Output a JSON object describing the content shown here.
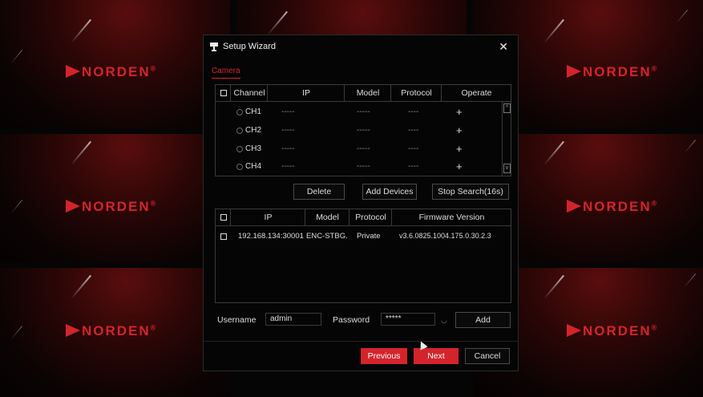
{
  "background": {
    "brand_logo": "NORDEN",
    "brand_mark": "®",
    "brand_color": "#d4242b"
  },
  "dialog": {
    "title": "Setup Wizard",
    "title_icon": "camera-icon",
    "close_icon": "close-icon",
    "tab": "Camera",
    "channel_table": {
      "headers": [
        "Channel",
        "IP",
        "Model",
        "Protocol",
        "Operate"
      ],
      "rows": [
        {
          "channel": "CH1",
          "ip": "-----",
          "model": "-----",
          "protocol": "----",
          "operate": "+"
        },
        {
          "channel": "CH2",
          "ip": "-----",
          "model": "-----",
          "protocol": "----",
          "operate": "+"
        },
        {
          "channel": "CH3",
          "ip": "-----",
          "model": "-----",
          "protocol": "----",
          "operate": "+"
        },
        {
          "channel": "CH4",
          "ip": "-----",
          "model": "-----",
          "protocol": "----",
          "operate": "+"
        }
      ]
    },
    "buttons": {
      "delete": "Delete",
      "add_devices": "Add Devices",
      "stop_search": "Stop Search(16s)"
    },
    "device_table": {
      "headers": [
        "IP",
        "Model",
        "Protocol",
        "Firmware Version"
      ],
      "rows": [
        {
          "ip": "192.168.134:30001",
          "model": "ENC-STBG.",
          "protocol": "Private",
          "firmware": "v3.6.0825.1004.175.0.30.2.3"
        }
      ]
    },
    "credentials": {
      "username_label": "Username",
      "username_value": "admin",
      "password_label": "Password",
      "password_value": "*****",
      "add_label": "Add"
    },
    "footer": {
      "previous": "Previous",
      "next": "Next",
      "cancel": "Cancel"
    }
  }
}
